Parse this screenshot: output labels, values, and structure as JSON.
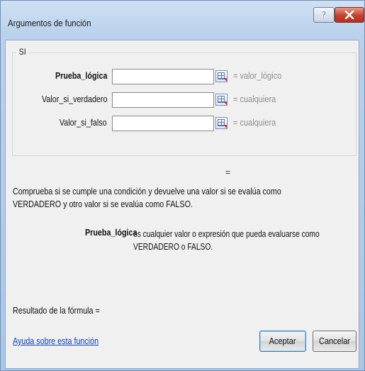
{
  "window": {
    "title": "Argumentos de función"
  },
  "function": {
    "name": "SI",
    "arguments": [
      {
        "label": "Prueba_lógica",
        "bold": true,
        "value": "",
        "result": "= valor_lógico"
      },
      {
        "label": "Valor_si_verdadero",
        "bold": false,
        "value": "",
        "result": "= cualquiera"
      },
      {
        "label": "Valor_si_falso",
        "bold": false,
        "value": "",
        "result": "= cualquiera"
      }
    ],
    "result_eq": "=",
    "description": "Comprueba si se cumple una condición y devuelve una valor si se evalúa como VERDADERO y otro valor si se evalúa como FALSO.",
    "arg_help": {
      "name": "Prueba_lógica",
      "text": "es cualquier valor o expresión que pueda evaluarse como VERDADERO o FALSO."
    }
  },
  "footer": {
    "formula_result": "Resultado de la fórmula =",
    "help_link": "Ayuda sobre esta función",
    "ok_label": "Aceptar",
    "cancel_label": "Cancelar"
  },
  "colors": {
    "title_gradient_top": "#cfe0f3",
    "close_button": "#c8402c",
    "link": "#0b3fb3",
    "hint_text": "#8e8e8e",
    "dialog_face": "#f0f0f0"
  },
  "icons": {
    "help": "help-icon",
    "close": "close-icon",
    "range_select": "range-select-icon"
  }
}
